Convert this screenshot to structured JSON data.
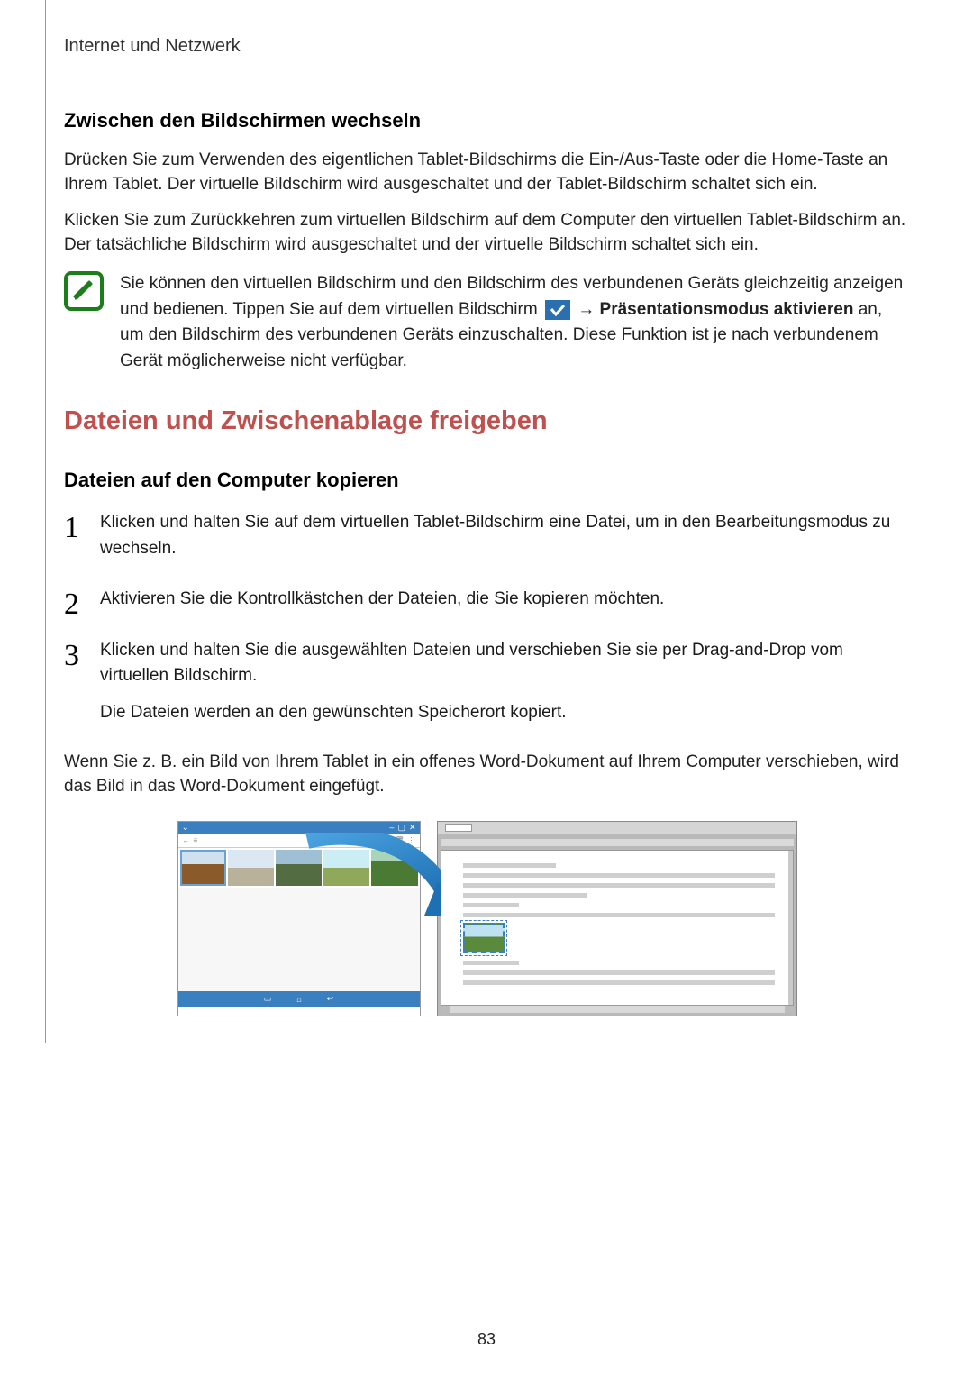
{
  "breadcrumb": "Internet und Netzwerk",
  "s1": {
    "heading": "Zwischen den Bildschirmen wechseln",
    "p1": "Drücken Sie zum Verwenden des eigentlichen Tablet-Bildschirms die Ein-/Aus-Taste oder die Home-Taste an Ihrem Tablet. Der virtuelle Bildschirm wird ausgeschaltet und der Tablet-Bildschirm schaltet sich ein.",
    "p2": "Klicken Sie zum Zurückkehren zum virtuellen Bildschirm auf dem Computer den virtuellen Tablet-Bildschirm an. Der tatsächliche Bildschirm wird ausgeschaltet und der virtuelle Bildschirm schaltet sich ein."
  },
  "note": {
    "pre": "Sie können den virtuellen Bildschirm und den Bildschirm des verbundenen Geräts gleichzeitig anzeigen und bedienen. Tippen Sie auf dem virtuellen Bildschirm ",
    "arrow": " → ",
    "bold": "Präsentationsmodus aktivieren",
    "post": " an, um den Bildschirm des verbundenen Geräts einzuschalten. Diese Funktion ist je nach verbundenem Gerät möglicherweise nicht verfügbar."
  },
  "s2": {
    "heading": "Dateien und Zwischenablage freigeben",
    "sub": "Dateien auf den Computer kopieren",
    "steps": [
      "Klicken und halten Sie auf dem virtuellen Tablet-Bildschirm eine Datei, um in den Bearbeitungsmodus zu wechseln.",
      "Aktivieren Sie die Kontrollkästchen der Dateien, die Sie kopieren möchten.",
      "Klicken und halten Sie die ausgewählten Dateien und verschieben Sie sie per Drag-and-Drop vom virtuellen Bildschirm."
    ],
    "step3_extra": "Die Dateien werden an den gewünschten Speicherort kopiert.",
    "trailing": "Wenn Sie z. B. ein Bild von Ihrem Tablet in ein offenes Word-Dokument auf Ihrem Computer verschieben, wird das Bild in das Word-Dokument eingefügt."
  },
  "page_number": "83"
}
